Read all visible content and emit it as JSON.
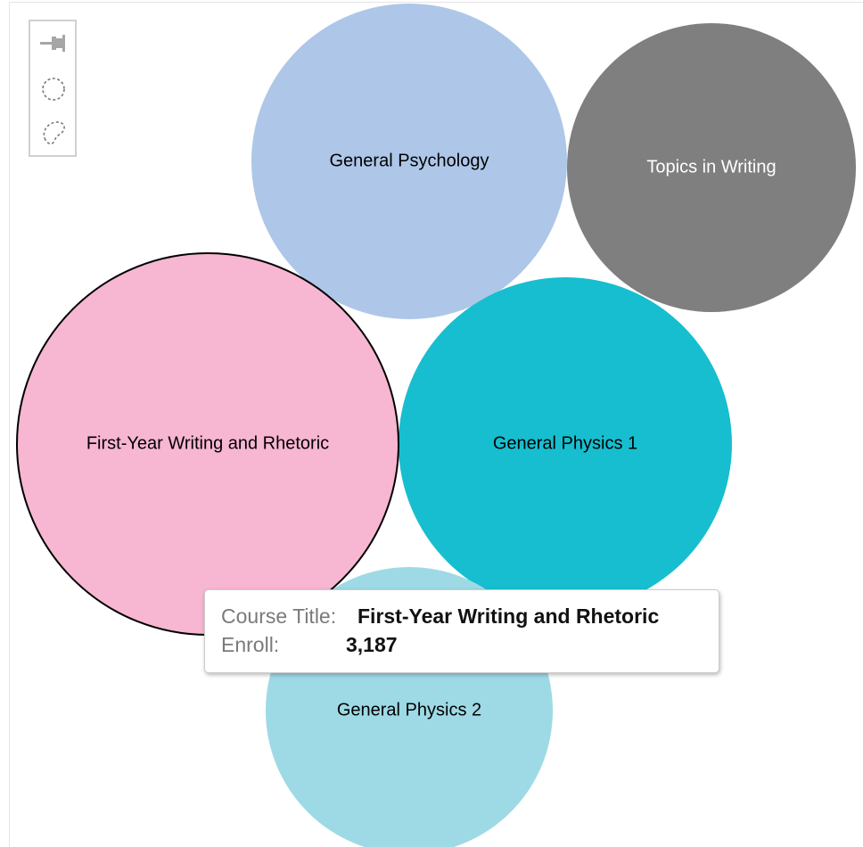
{
  "toolbar": {
    "tools": [
      {
        "name": "pin-tool",
        "icon": "pushpin-icon"
      },
      {
        "name": "circle-select-tool",
        "icon": "dashed-circle-icon"
      },
      {
        "name": "lasso-select-tool",
        "icon": "lasso-icon"
      }
    ]
  },
  "chart_data": {
    "type": "bubble",
    "title": "",
    "legend": "none",
    "grid": false,
    "size_field": "Enroll",
    "series": [
      {
        "label": "General Psychology",
        "color": "#aec7e8",
        "label_color": "#000000"
      },
      {
        "label": "Topics in Writing",
        "color": "#7f7f7f",
        "label_color": "#ffffff"
      },
      {
        "label": "First-Year Writing and Rhetoric",
        "enroll": 3187,
        "color": "#f7b6d2",
        "label_color": "#000000",
        "highlighted": true
      },
      {
        "label": "General Physics 1",
        "color": "#17becf",
        "label_color": "#000000"
      },
      {
        "label": "General Physics 2",
        "color": "#9edae5",
        "label_color": "#000000"
      }
    ]
  },
  "tooltip": {
    "course_title_key": "Course Title:",
    "course_title_value": "First-Year Writing and Rhetoric",
    "enroll_key": "Enroll:",
    "enroll_value": "3,187"
  }
}
